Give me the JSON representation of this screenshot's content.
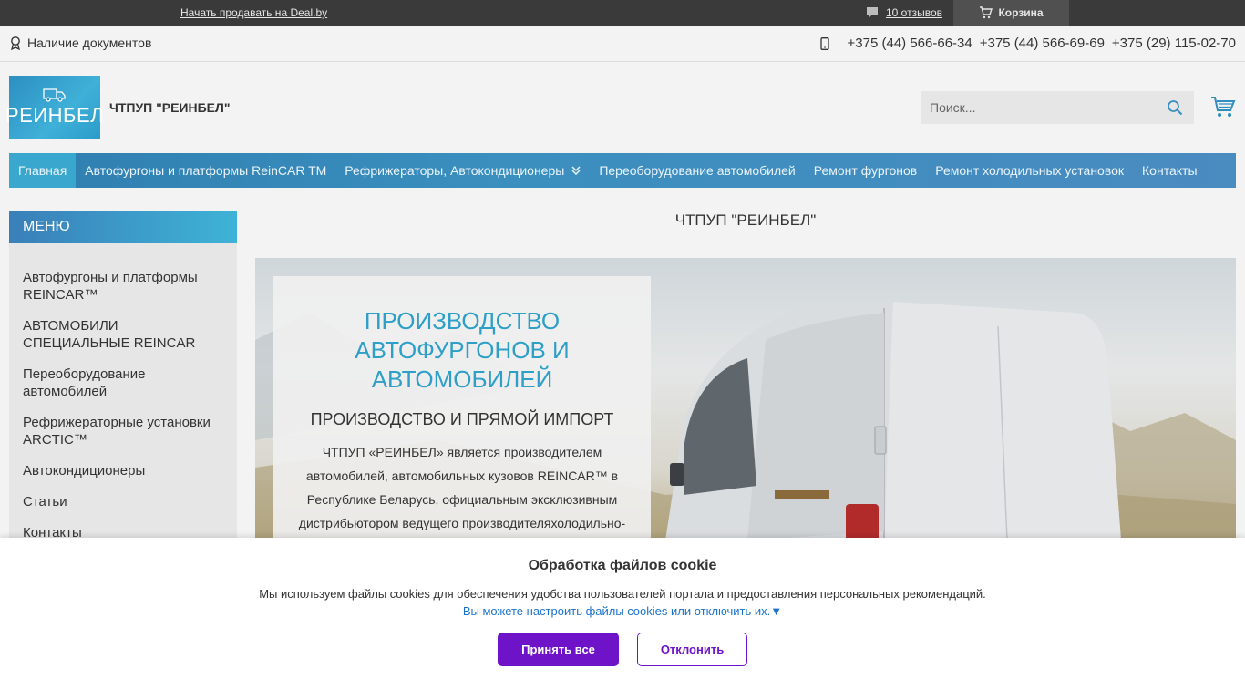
{
  "topbar": {
    "sell_link": "Начать продавать на Deal.by",
    "reviews_link": "10 отзывов",
    "cart_label": "Корзина"
  },
  "infobar": {
    "documents": "Наличие документов",
    "phones": [
      "+375 (44) 566-66-34",
      "+375 (44) 566-69-69",
      "+375 (29) 115-02-70"
    ]
  },
  "header": {
    "logo_text": "РЕИНБЕЛ",
    "company_name": "ЧТПУП \"РЕИНБЕЛ\"",
    "search_placeholder": "Поиск..."
  },
  "nav": {
    "items": [
      "Главная",
      "Автофургоны и платформы ReinCAR TM",
      "Рефрижераторы, Автокондиционеры",
      "Переоборудование автомобилей",
      "Ремонт фургонов",
      "Ремонт холодильных установок",
      "Контакты"
    ]
  },
  "sidebar": {
    "heading": "МЕНЮ",
    "items": [
      "Автофургоны и платформы REINCAR™",
      "АВТОМОБИЛИ СПЕЦИАЛЬНЫЕ REINCAR",
      "Переоборудование автомобилей",
      "Рефрижераторные установки ARCTIC™",
      "Автокондиционеры",
      "Статьи",
      "Контакты"
    ]
  },
  "main": {
    "title": "ЧТПУП \"РЕИНБЕЛ\"",
    "hero_heading": "ПРОИЗВОДСТВО АВТОФУРГОНОВ И АВТОМОБИЛЕЙ",
    "hero_subheading": "ПРОИЗВОДСТВО И ПРЯМОЙ ИМПОРТ",
    "hero_text": "ЧТПУП «РЕИНБЕЛ» является производителем автомобилей, автомобильных кузовов REINCAR™ в Республике Беларусь, официальным эксклюзивным дистрибьютором ведущего производителяхолодильно-"
  },
  "cookie": {
    "title": "Обработка файлов cookie",
    "text": "Мы используем файлы cookies для обеспечения удобства пользователей портала и предоставления персональных рекомендаций.",
    "settings_link": "Вы можете настроить файлы cookies или отключить их.▼",
    "accept_label": "Принять все",
    "decline_label": "Отклонить"
  },
  "colors": {
    "accent_blue": "#2e9fc7",
    "cookie_purple": "#6f13c9",
    "topbar": "#3a3a3a"
  }
}
